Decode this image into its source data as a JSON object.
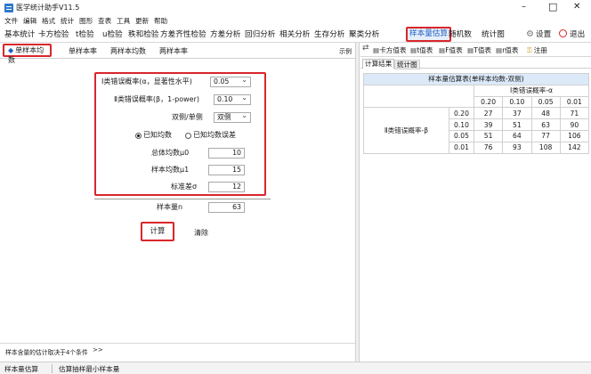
{
  "window": {
    "title": "医学统计助手V11.5",
    "minimize": "–",
    "maximize": "□",
    "close": "✕"
  },
  "menu": [
    "文件",
    "编辑",
    "格式",
    "统计",
    "图形",
    "查表",
    "工具",
    "更新",
    "帮助"
  ],
  "toolbar": {
    "items": [
      "基本统计",
      "卡方检验",
      "t检验",
      "u检验",
      "秩和检验",
      "方差齐性检验",
      "方差分析",
      "回归分析",
      "相关分析",
      "生存分析",
      "聚类分析",
      "样本量估算",
      "随机数",
      "统计图"
    ],
    "active": "样本量估算",
    "settings": "设置",
    "exit": "退出"
  },
  "sub_tabs": {
    "items": [
      "单样本均数",
      "单样本率",
      "两样本均数",
      "两样本率"
    ],
    "active": "单样本均数",
    "example": "示例"
  },
  "form": {
    "alpha_label": "Ⅰ类错误概率(α，显著性水平)",
    "alpha_value": "0.05",
    "beta_label": "Ⅱ类错误概率(β，1-power)",
    "beta_value": "0.10",
    "side_label": "双侧/单侧",
    "side_value": "双侧",
    "radio_known_mean": "已知均数",
    "radio_known_diff": "已知均数误差",
    "mu0_label": "总体均数μ0",
    "mu0_value": "10",
    "mu1_label": "样本均数μ1",
    "mu1_value": "15",
    "sd_label": "标准差σ",
    "sd_value": "12",
    "n_label": "样本量n",
    "n_value": "63",
    "calc_button": "计算",
    "clear_button": "清除"
  },
  "bottom_hint": {
    "text": "样本含量的估计取决于4个条件",
    "more": ">>"
  },
  "right_toolbar": {
    "items": [
      "卡方值表",
      "t值表",
      "F值表",
      "T值表",
      "r值表"
    ],
    "note": "注册"
  },
  "result_tabs": {
    "items": [
      "计算结果",
      "统计图"
    ],
    "active": "计算结果"
  },
  "result_table": {
    "title": "样本量估算表(单样本均数-双侧)",
    "col_group": "Ⅰ类错误概率-α",
    "col_headers": [
      "0.20",
      "0.10",
      "0.05",
      "0.01"
    ],
    "row_group": "Ⅱ类错误概率-β",
    "rows": [
      {
        "beta": "0.20",
        "values": [
          "27",
          "37",
          "48",
          "71"
        ]
      },
      {
        "beta": "0.10",
        "values": [
          "39",
          "51",
          "63",
          "90"
        ]
      },
      {
        "beta": "0.05",
        "values": [
          "51",
          "64",
          "77",
          "106"
        ]
      },
      {
        "beta": "0.01",
        "values": [
          "76",
          "93",
          "108",
          "142"
        ]
      }
    ]
  },
  "status_bar": {
    "left": "样本量估算",
    "right": "估算抽样最小样本量"
  },
  "colors": {
    "accent_red": "#d9262c",
    "selected_blue": "#1f5fbf",
    "result_header_bg": "#dbe9f8"
  }
}
